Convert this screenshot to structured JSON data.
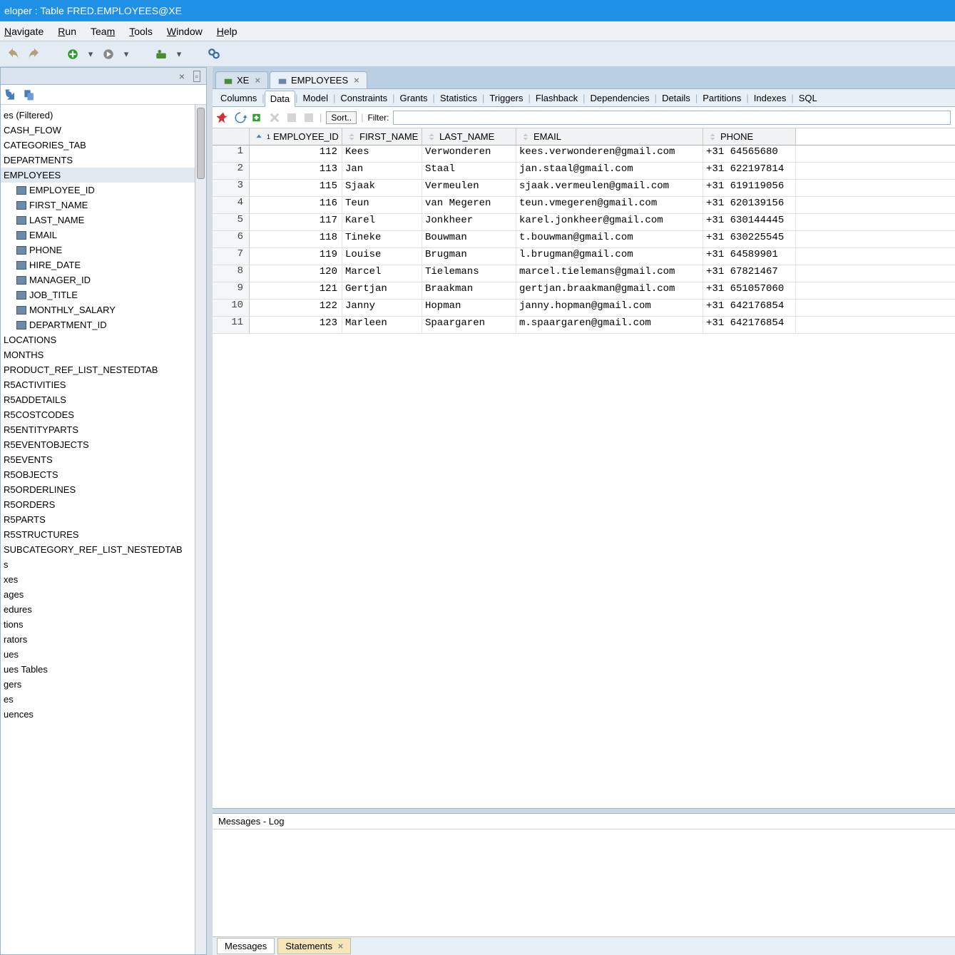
{
  "titlebar": "eloper : Table FRED.EMPLOYEES@XE",
  "menubar": [
    "Navigate",
    "Run",
    "Team",
    "Tools",
    "Window",
    "Help"
  ],
  "conn_tabs": [
    {
      "label": "XE",
      "active": false
    },
    {
      "label": "EMPLOYEES",
      "active": true
    }
  ],
  "subtabs": [
    "Columns",
    "Data",
    "Model",
    "Constraints",
    "Grants",
    "Statistics",
    "Triggers",
    "Flashback",
    "Dependencies",
    "Details",
    "Partitions",
    "Indexes",
    "SQL"
  ],
  "subtab_active": "Data",
  "grid_toolbar": {
    "sort_label": "Sort..",
    "filter_label": "Filter:",
    "filter_value": ""
  },
  "grid_columns": [
    "EMPLOYEE_ID",
    "FIRST_NAME",
    "LAST_NAME",
    "EMAIL",
    "PHONE"
  ],
  "grid_rows": [
    {
      "n": 1,
      "id": 112,
      "fn": "Kees",
      "ln": "Verwonderen",
      "em": "kees.verwonderen@gmail.com",
      "ph": "+31 64565680"
    },
    {
      "n": 2,
      "id": 113,
      "fn": "Jan",
      "ln": "Staal",
      "em": "jan.staal@gmail.com",
      "ph": "+31 622197814"
    },
    {
      "n": 3,
      "id": 115,
      "fn": "Sjaak",
      "ln": "Vermeulen",
      "em": "sjaak.vermeulen@gmail.com",
      "ph": "+31 619119056"
    },
    {
      "n": 4,
      "id": 116,
      "fn": "Teun",
      "ln": "van Megeren",
      "em": "teun.vmegeren@gmail.com",
      "ph": "+31 620139156"
    },
    {
      "n": 5,
      "id": 117,
      "fn": "Karel",
      "ln": "Jonkheer",
      "em": "karel.jonkheer@gmail.com",
      "ph": "+31 630144445"
    },
    {
      "n": 6,
      "id": 118,
      "fn": "Tineke",
      "ln": "Bouwman",
      "em": "t.bouwman@gmail.com",
      "ph": "+31 630225545"
    },
    {
      "n": 7,
      "id": 119,
      "fn": "Louise",
      "ln": "Brugman",
      "em": "l.brugman@gmail.com",
      "ph": "+31 64589901"
    },
    {
      "n": 8,
      "id": 120,
      "fn": "Marcel",
      "ln": "Tielemans",
      "em": "marcel.tielemans@gmail.com",
      "ph": "+31 67821467"
    },
    {
      "n": 9,
      "id": 121,
      "fn": "Gertjan",
      "ln": "Braakman",
      "em": "gertjan.braakman@gmail.com",
      "ph": "+31 651057060"
    },
    {
      "n": 10,
      "id": 122,
      "fn": "Janny",
      "ln": "Hopman",
      "em": "janny.hopman@gmail.com",
      "ph": "+31 642176854"
    },
    {
      "n": 11,
      "id": 123,
      "fn": "Marleen",
      "ln": "Spaargaren",
      "em": "m.spaargaren@gmail.com",
      "ph": "+31 642176854"
    }
  ],
  "tree": {
    "tables": [
      "es (Filtered)",
      "CASH_FLOW",
      "CATEGORIES_TAB",
      "DEPARTMENTS",
      "EMPLOYEES"
    ],
    "employees_cols": [
      "EMPLOYEE_ID",
      "FIRST_NAME",
      "LAST_NAME",
      "EMAIL",
      "PHONE",
      "HIRE_DATE",
      "MANAGER_ID",
      "JOB_TITLE",
      "MONTHLY_SALARY",
      "DEPARTMENT_ID"
    ],
    "after": [
      "LOCATIONS",
      "MONTHS",
      "PRODUCT_REF_LIST_NESTEDTAB",
      "R5ACTIVITIES",
      "R5ADDETAILS",
      "R5COSTCODES",
      "R5ENTITYPARTS",
      "R5EVENTOBJECTS",
      "R5EVENTS",
      "R5OBJECTS",
      "R5ORDERLINES",
      "R5ORDERS",
      "R5PARTS",
      "R5STRUCTURES",
      "SUBCATEGORY_REF_LIST_NESTEDTAB",
      "s",
      "xes",
      "ages",
      "edures",
      "tions",
      "rators",
      "ues",
      "ues Tables",
      "gers",
      "es",
      "uences"
    ]
  },
  "log": {
    "header": "Messages - Log",
    "tabs": [
      "Messages",
      "Statements"
    ],
    "active": "Statements"
  }
}
